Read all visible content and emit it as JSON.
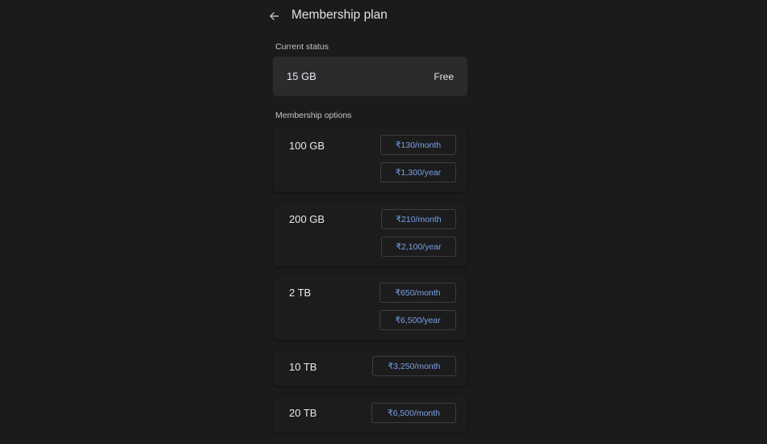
{
  "header": {
    "title": "Membership plan",
    "back_icon": "arrow-left-icon"
  },
  "current_status": {
    "label": "Current status",
    "capacity": "15 GB",
    "plan": "Free"
  },
  "membership_options": {
    "label": "Membership options",
    "options": [
      {
        "capacity": "100 GB",
        "prices": [
          "₹130/month",
          "₹1,300/year"
        ]
      },
      {
        "capacity": "200 GB",
        "prices": [
          "₹210/month",
          "₹2,100/year"
        ]
      },
      {
        "capacity": "2 TB",
        "prices": [
          "₹650/month",
          "₹6,500/year"
        ]
      },
      {
        "capacity": "10 TB",
        "prices": [
          "₹3,250/month"
        ]
      },
      {
        "capacity": "20 TB",
        "prices": [
          "₹6,500/month"
        ]
      }
    ]
  },
  "colors": {
    "background": "#1b1b1c",
    "price_text": "#7ba1e6",
    "status_card": "#2a2b2d"
  }
}
